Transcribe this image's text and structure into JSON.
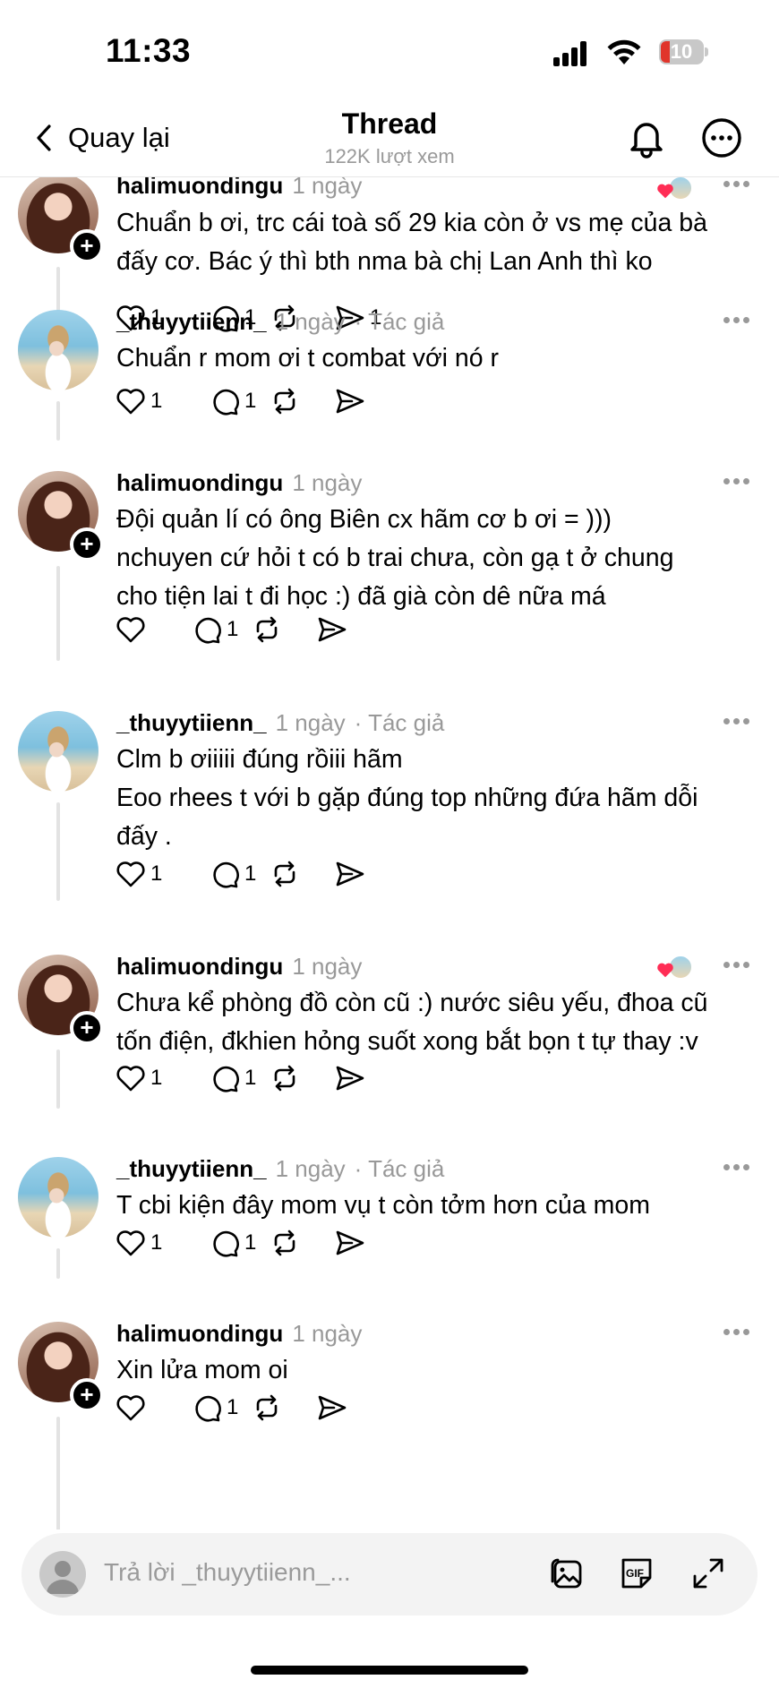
{
  "status_bar": {
    "time": "11:33",
    "battery": "10"
  },
  "nav": {
    "back_label": "Quay lại",
    "title": "Thread",
    "views": "122K lượt xem"
  },
  "posts": [
    {
      "username": "halimuondingu",
      "time": "1 ngày",
      "author_tag": "",
      "avatar": "girl",
      "follow_badge": "+",
      "liked_by_author": true,
      "lines": [
        "Chuẩn b ơi, trc cái toà số 29 kia còn ở vs mẹ của bà",
        "đấy cơ. Bác ý thì bth nma bà chị Lan Anh thì ko"
      ],
      "like_count": "1",
      "reply_count": "1",
      "share_count": "1"
    },
    {
      "username": "_thuyytiienn_",
      "time": "1 ngày",
      "author_tag": "· Tác giả",
      "avatar": "beach",
      "follow_badge": "",
      "liked_by_author": false,
      "lines": [
        "Chuẩn r mom ơi t combat với nó r"
      ],
      "like_count": "1",
      "reply_count": "1",
      "share_count": ""
    },
    {
      "username": "halimuondingu",
      "time": "1 ngày",
      "author_tag": "",
      "avatar": "girl",
      "follow_badge": "+",
      "liked_by_author": false,
      "lines": [
        "Đội quản lí có ông Biên cx hãm cơ b ơi = )))",
        "nchuyen cứ hỏi t có b trai chưa, còn gạ t ở chung",
        "cho tiện lai t đi học :) đã già còn dê nữa má"
      ],
      "like_count": "",
      "reply_count": "1",
      "share_count": ""
    },
    {
      "username": "_thuyytiienn_",
      "time": "1 ngày",
      "author_tag": "· Tác giả",
      "avatar": "beach",
      "follow_badge": "",
      "liked_by_author": false,
      "lines": [
        "Clm b ơiiiii đúng rồiii hãm",
        "Eoo rhees t với b gặp đúng top những đứa hãm dỗi",
        "đấy ."
      ],
      "like_count": "1",
      "reply_count": "1",
      "share_count": ""
    },
    {
      "username": "halimuondingu",
      "time": "1 ngày",
      "author_tag": "",
      "avatar": "girl",
      "follow_badge": "+",
      "liked_by_author": true,
      "lines": [
        "Chưa kể phòng đồ còn cũ :) nước siêu yếu, đhoa cũ",
        "tốn điện, đkhien hỏng suốt xong bắt bọn t tự thay :v"
      ],
      "like_count": "1",
      "reply_count": "1",
      "share_count": ""
    },
    {
      "username": "_thuyytiienn_",
      "time": "1 ngày",
      "author_tag": "· Tác giả",
      "avatar": "beach",
      "follow_badge": "",
      "liked_by_author": false,
      "lines": [
        "T cbi kiện đây mom vụ t còn tởm hơn của mom"
      ],
      "like_count": "1",
      "reply_count": "1",
      "share_count": ""
    },
    {
      "username": "halimuondingu",
      "time": "1 ngày",
      "author_tag": "",
      "avatar": "girl",
      "follow_badge": "+",
      "liked_by_author": false,
      "lines": [
        "Xin lửa mom oi"
      ],
      "like_count": "",
      "reply_count": "1",
      "share_count": ""
    }
  ],
  "reply": {
    "placeholder": "Trả lời _thuyytiienn_..."
  },
  "colors": {
    "heart": "#ff2d55",
    "muted": "#999999",
    "text": "#000000"
  }
}
